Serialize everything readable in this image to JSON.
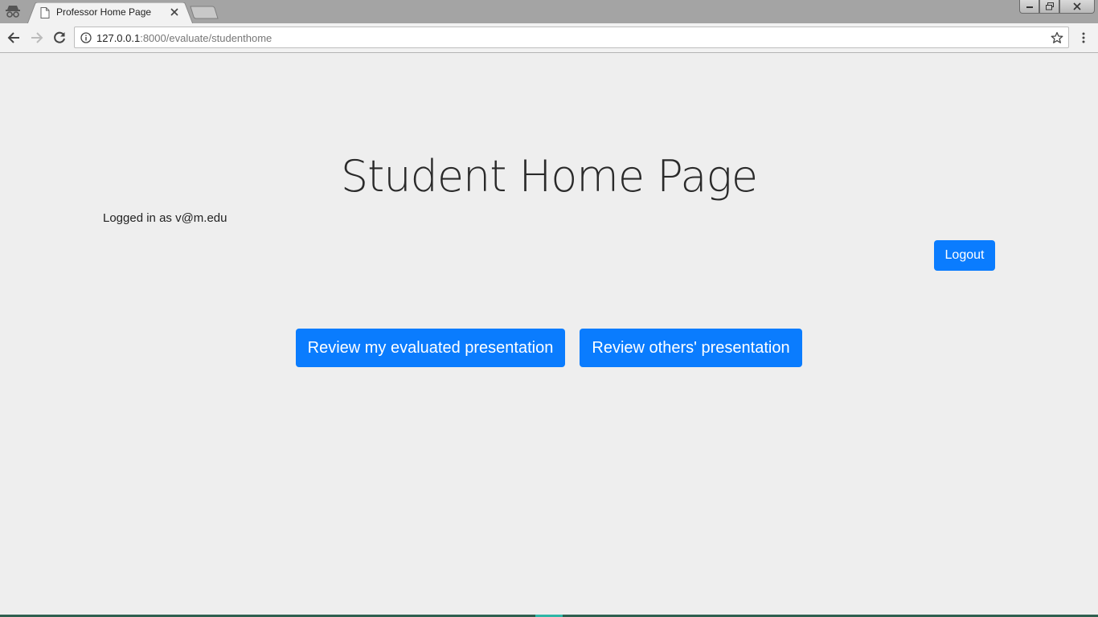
{
  "browser": {
    "tab_title": "Professor Home Page",
    "url_host": "127.0.0.1",
    "url_rest": ":8000/evaluate/studenthome"
  },
  "page": {
    "title": "Student Home Page",
    "logged_in_text": "Logged in as v@m.edu",
    "logout_label": "Logout",
    "review_mine_label": "Review my evaluated presentation",
    "review_others_label": "Review others' presentation"
  },
  "colors": {
    "primary_button": "#0a7cfe",
    "page_background": "#eeeeee"
  },
  "icons": [
    "incognito-icon",
    "page-icon",
    "close-icon",
    "back-arrow-icon",
    "forward-arrow-icon",
    "reload-icon",
    "info-icon",
    "star-icon",
    "menu-dots-icon"
  ]
}
